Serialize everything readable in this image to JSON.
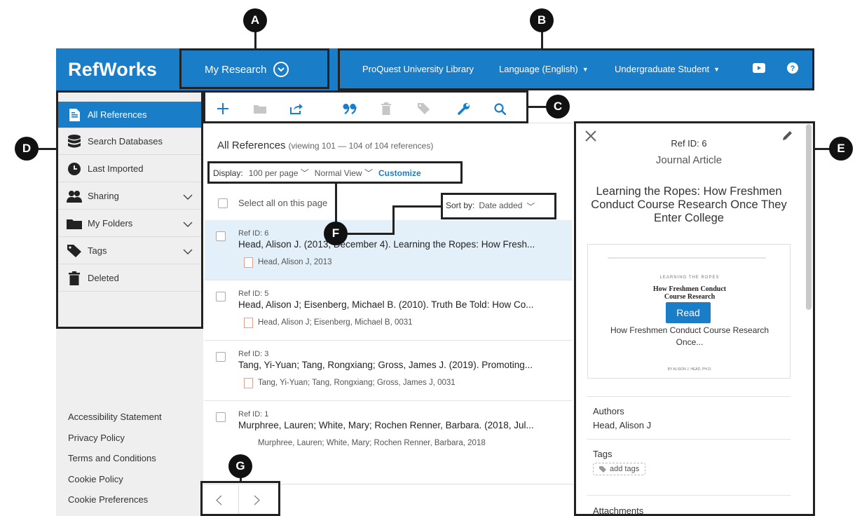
{
  "callouts": [
    "A",
    "B",
    "C",
    "D",
    "E",
    "F",
    "G"
  ],
  "header": {
    "brand": "RefWorks",
    "workspace": "My Research",
    "library": "ProQuest University Library",
    "language": "Language (English)",
    "role": "Undergraduate Student"
  },
  "toolbar": {
    "icons": [
      "plus-icon",
      "folder-icon",
      "share-icon",
      "quote-icon",
      "trash-icon",
      "tag-icon",
      "wrench-icon",
      "search-icon"
    ]
  },
  "sidebar": {
    "items": [
      {
        "label": "All References",
        "icon": "document-icon",
        "active": true
      },
      {
        "label": "Search Databases",
        "icon": "database-icon"
      },
      {
        "label": "Last Imported",
        "icon": "clock-icon"
      },
      {
        "label": "Sharing",
        "icon": "people-icon",
        "expandable": true
      },
      {
        "label": "My Folders",
        "icon": "folder-icon",
        "expandable": true
      },
      {
        "label": "Tags",
        "icon": "tag-icon",
        "expandable": true
      },
      {
        "label": "Deleted",
        "icon": "trash-icon"
      }
    ],
    "footer": [
      "Accessibility Statement",
      "Privacy Policy",
      "Terms and Conditions",
      "Cookie Policy",
      "Cookie Preferences"
    ]
  },
  "list": {
    "title": "All References",
    "viewing": "(viewing 101 — 104 of 104 references)",
    "display_label": "Display:",
    "per_page": "100 per page",
    "view_mode": "Normal View",
    "customize": "Customize",
    "select_all": "Select all on this page",
    "sort_label": "Sort by:",
    "sort_value": "Date added",
    "refs": [
      {
        "id": "Ref ID: 6",
        "title": "Head, Alison J. (2013, December 4). Learning the Ropes: How Fresh...",
        "sub": "Head, Alison J, 2013"
      },
      {
        "id": "Ref ID: 5",
        "title": "Head, Alison J; Eisenberg, Michael B. (2010). Truth Be Told: How Co...",
        "sub": "Head, Alison J; Eisenberg, Michael B, 0031"
      },
      {
        "id": "Ref ID: 3",
        "title": "Tang, Yi-Yuan; Tang, Rongxiang; Gross, James J. (2019). Promoting...",
        "sub": "Tang, Yi-Yuan; Tang, Rongxiang; Gross, James J, 0031"
      },
      {
        "id": "Ref ID: 1",
        "title": "Murphree, Lauren; White, Mary; Rochen Renner, Barbara. (2018, Jul...",
        "sub": "Murphree, Lauren; White, Mary; Rochen Renner, Barbara, 2018"
      }
    ]
  },
  "detail": {
    "ref_id": "Ref ID: 6",
    "type": "Journal Article",
    "title": "Learning the Ropes: How Freshmen Conduct Course Research Once They Enter College",
    "preview_heading": "LEARNING THE ROPES",
    "preview_title": "How Freshmen Conduct Course Research",
    "preview_byline": "BY ALISON J. HEAD, PH.D.",
    "read_label": "Read",
    "preview_caption": "How Freshmen Conduct Course Research Once...",
    "authors_label": "Authors",
    "authors": "Head, Alison J",
    "tags_label": "Tags",
    "add_tags": "add tags",
    "attachments_label": "Attachments"
  },
  "colors": {
    "brand_blue": "#1a7dc8",
    "selected_row": "#e3f0fa",
    "sidebar_bg": "#efefef"
  }
}
